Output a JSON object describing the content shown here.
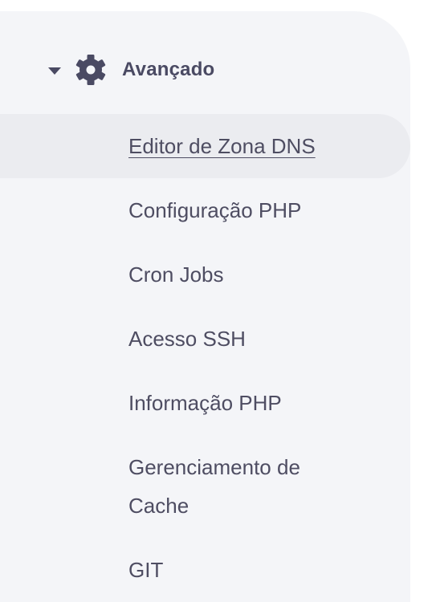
{
  "section": {
    "title": "Avançado",
    "icon": "gear-icon",
    "expanded": true
  },
  "menu": {
    "items": [
      {
        "label": "Editor de Zona DNS",
        "active": true
      },
      {
        "label": "Configuração PHP",
        "active": false
      },
      {
        "label": "Cron Jobs",
        "active": false
      },
      {
        "label": "Acesso SSH",
        "active": false
      },
      {
        "label": "Informação PHP",
        "active": false
      },
      {
        "label": "Gerenciamento de Cache",
        "active": false
      },
      {
        "label": "GIT",
        "active": false
      }
    ]
  },
  "colors": {
    "panel_bg": "#f4f5f8",
    "active_bg": "#ebecf0",
    "text": "#4e4d62",
    "icon": "#4a4a63"
  }
}
